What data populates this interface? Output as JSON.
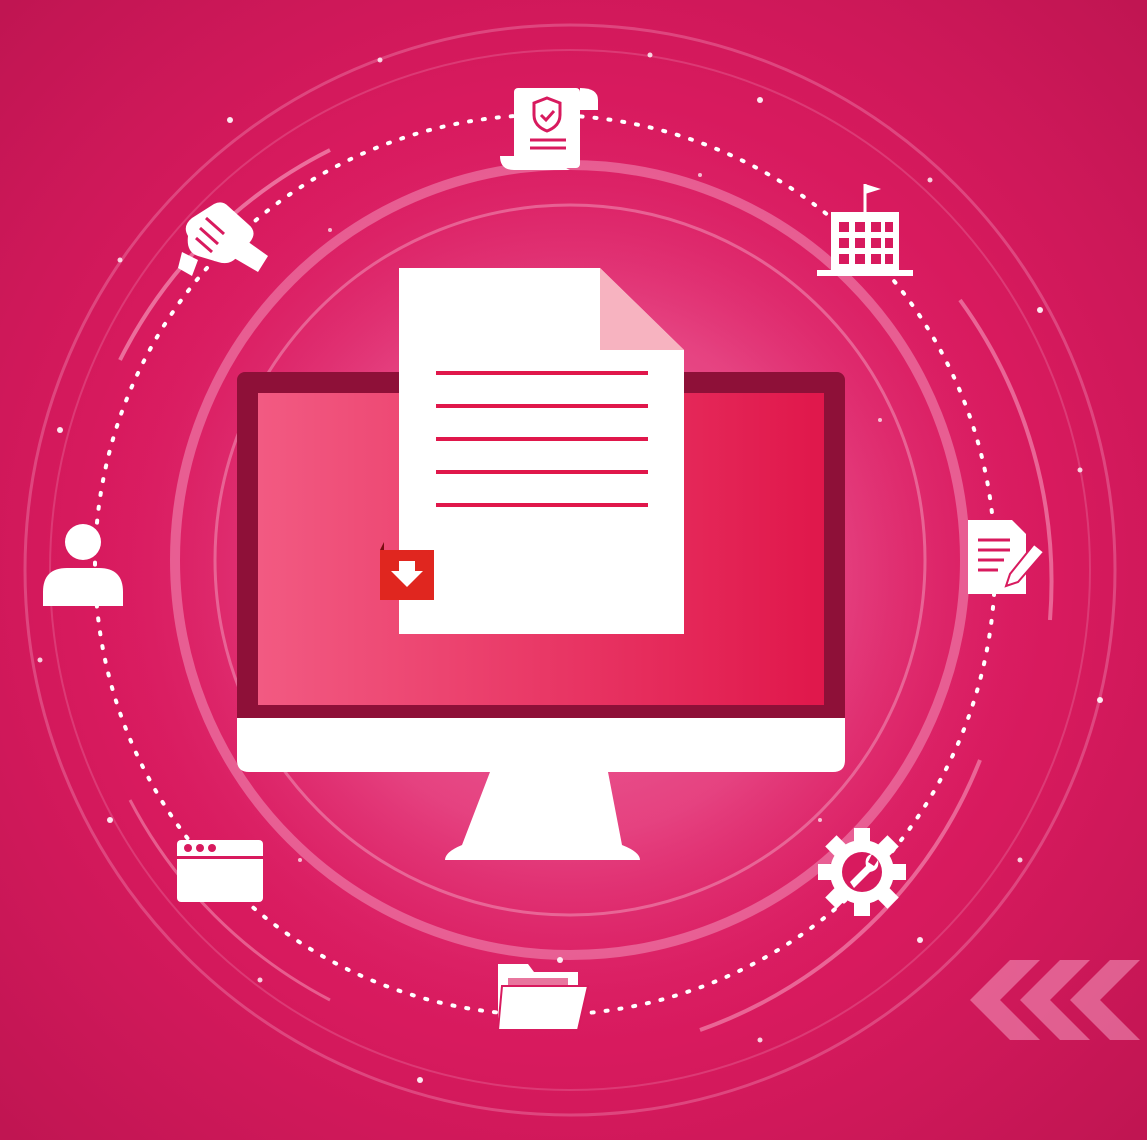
{
  "scene": {
    "description_free": true,
    "colors": {
      "background": "#d81a5e",
      "background_dark": "#b3124c",
      "glow": "#f07aa8",
      "screen_left": "#f25a82",
      "screen_right": "#e0174b",
      "monitor_frame": "#8e1038",
      "document_fold": "#f7b3c0",
      "document_line": "#e0174b",
      "download_badge": "#e0261f",
      "white": "#ffffff"
    }
  },
  "icons": {
    "center": [
      "monitor-icon",
      "document-icon",
      "download-icon"
    ],
    "orbit": [
      "certificate-icon",
      "building-icon",
      "document-edit-icon",
      "gear-wrench-icon",
      "folder-icon",
      "browser-window-icon",
      "user-icon",
      "handshake-icon"
    ],
    "decor": [
      "chevrons-left-icon"
    ]
  }
}
